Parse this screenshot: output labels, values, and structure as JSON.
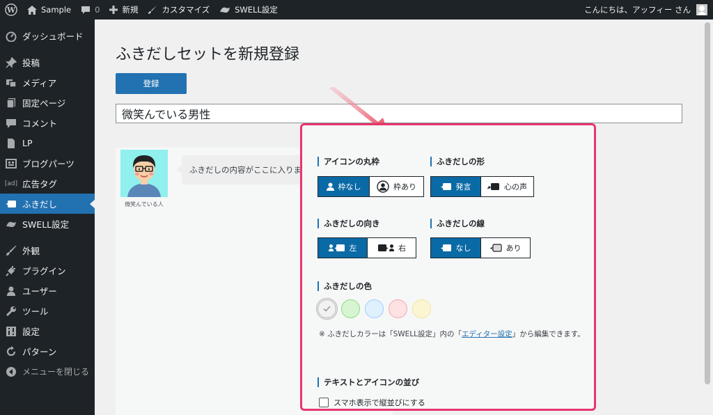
{
  "adminbar": {
    "site_name": "Sample",
    "comments_count": "0",
    "new_label": "新規",
    "customize_label": "カスタマイズ",
    "swell_label": "SWELL設定",
    "greeting": "こんにちは、アッフィー さん"
  },
  "sidebar": {
    "items": [
      {
        "label": "ダッシュボード",
        "icon": "dashboard-icon"
      },
      {
        "label": "投稿",
        "icon": "pin-icon"
      },
      {
        "label": "メディア",
        "icon": "media-icon"
      },
      {
        "label": "固定ページ",
        "icon": "page-icon"
      },
      {
        "label": "コメント",
        "icon": "comment-icon"
      },
      {
        "label": "LP",
        "icon": "doc-icon"
      },
      {
        "label": "ブログパーツ",
        "icon": "grid-icon"
      },
      {
        "label": "広告タグ",
        "icon": "ad-icon"
      },
      {
        "label": "ふきだし",
        "icon": "balloon-icon"
      },
      {
        "label": "SWELL設定",
        "icon": "swell-icon"
      },
      {
        "label": "外観",
        "icon": "brush-icon"
      },
      {
        "label": "プラグイン",
        "icon": "plug-icon"
      },
      {
        "label": "ユーザー",
        "icon": "user-icon"
      },
      {
        "label": "ツール",
        "icon": "wrench-icon"
      },
      {
        "label": "設定",
        "icon": "settings-icon"
      },
      {
        "label": "パターン",
        "icon": "pattern-icon"
      },
      {
        "label": "メニューを閉じる",
        "icon": "collapse-icon"
      }
    ]
  },
  "main": {
    "title": "ふきだしセットを新規登録",
    "submit_label": "登録",
    "title_value": "微笑んでいる男性"
  },
  "preview": {
    "avatar_name": "微笑んでいる人",
    "bubble_text": "ふきだしの内容がここに入ります"
  },
  "panel": {
    "border_frame": "アイコンの丸枠",
    "border_options": [
      "枠なし",
      "枠あり"
    ],
    "shape": "ふきだしの形",
    "shape_options": [
      "発言",
      "心の声"
    ],
    "direction": "ふきだしの向き",
    "direction_options": [
      "左",
      "右"
    ],
    "line": "ふきだしの線",
    "line_options": [
      "なし",
      "あり"
    ],
    "color": "ふきだしの色",
    "note_pre": "※ ふきだしカラーは「SWELL設定」内の「",
    "note_link": "エディター設定",
    "note_post": "」から編集できます。",
    "arrangement": "テキストとアイコンの並び",
    "checkbox_label": "スマホ表示で縦並びにする"
  },
  "colors": {
    "accent": "#2271b1",
    "active_segment": "#0a6aa6",
    "highlight_frame": "#e8356f",
    "swatches": [
      "#f2f2f2",
      "#d6f5d0",
      "#dff1fd",
      "#fde2e4",
      "#fcf5d3"
    ],
    "swatch_borders": [
      "#b0b0b0",
      "#86dd7b",
      "#99cfff",
      "#f7a4ad",
      "#f4e497"
    ]
  }
}
